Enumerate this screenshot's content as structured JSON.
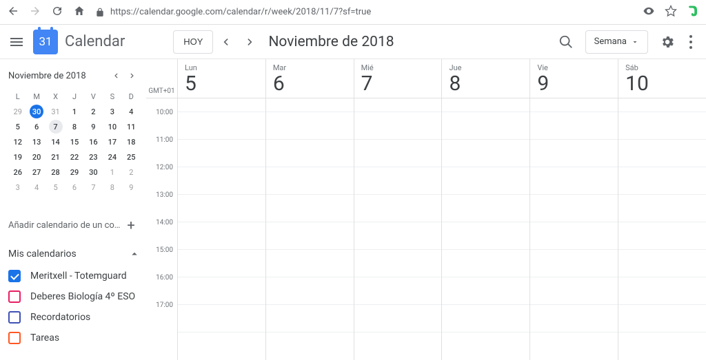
{
  "browser": {
    "url": "https://calendar.google.com/calendar/r/week/2018/11/7?sf=true"
  },
  "header": {
    "logo_day": "31",
    "app_title": "Calendar",
    "today_btn": "HOY",
    "month_label": "Noviembre de 2018",
    "view_label": "Semana"
  },
  "mini_cal": {
    "title": "Noviembre de 2018",
    "dow": [
      "L",
      "M",
      "X",
      "J",
      "V",
      "S",
      "D"
    ],
    "weeks": [
      [
        {
          "n": "29",
          "other": true
        },
        {
          "n": "30",
          "today": true
        },
        {
          "n": "31",
          "other": true
        },
        {
          "n": "1"
        },
        {
          "n": "2"
        },
        {
          "n": "3"
        },
        {
          "n": "4"
        }
      ],
      [
        {
          "n": "5"
        },
        {
          "n": "6"
        },
        {
          "n": "7",
          "sel": true
        },
        {
          "n": "8"
        },
        {
          "n": "9"
        },
        {
          "n": "10"
        },
        {
          "n": "11"
        }
      ],
      [
        {
          "n": "12"
        },
        {
          "n": "13"
        },
        {
          "n": "14"
        },
        {
          "n": "15"
        },
        {
          "n": "16"
        },
        {
          "n": "17"
        },
        {
          "n": "18"
        }
      ],
      [
        {
          "n": "19"
        },
        {
          "n": "20"
        },
        {
          "n": "21"
        },
        {
          "n": "22"
        },
        {
          "n": "23"
        },
        {
          "n": "24"
        },
        {
          "n": "25"
        }
      ],
      [
        {
          "n": "26"
        },
        {
          "n": "27"
        },
        {
          "n": "28"
        },
        {
          "n": "29"
        },
        {
          "n": "30"
        },
        {
          "n": "1",
          "other": true
        },
        {
          "n": "2",
          "other": true
        }
      ],
      [
        {
          "n": "3",
          "other": true
        },
        {
          "n": "4",
          "other": true
        },
        {
          "n": "5",
          "other": true
        },
        {
          "n": "6",
          "other": true
        },
        {
          "n": "7",
          "other": true
        },
        {
          "n": "8",
          "other": true
        },
        {
          "n": "9",
          "other": true
        }
      ]
    ]
  },
  "add_cal": {
    "label": "Añadir calendario de un co…"
  },
  "my_cals": {
    "header": "Mis calendarios",
    "items": [
      {
        "label": "Meritxell - Totemguard",
        "color": "#1a73e8",
        "checked": true
      },
      {
        "label": "Deberes Biología 4º ESO",
        "color": "#e91e63",
        "checked": false
      },
      {
        "label": "Recordatorios",
        "color": "#3f51b5",
        "checked": false
      },
      {
        "label": "Tareas",
        "color": "#ff5722",
        "checked": false
      }
    ]
  },
  "week": {
    "timezone": "GMT+01",
    "days": [
      {
        "dow": "Lun",
        "num": "5"
      },
      {
        "dow": "Mar",
        "num": "6"
      },
      {
        "dow": "Mié",
        "num": "7"
      },
      {
        "dow": "Jue",
        "num": "8"
      },
      {
        "dow": "Vie",
        "num": "9"
      },
      {
        "dow": "Sáb",
        "num": "10"
      }
    ],
    "hours": [
      "10:00",
      "11:00",
      "12:00",
      "13:00",
      "14:00",
      "15:00",
      "16:00",
      "17:00"
    ]
  }
}
